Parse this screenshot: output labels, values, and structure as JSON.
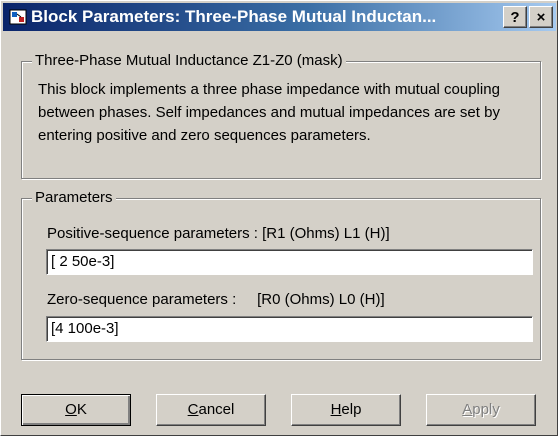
{
  "window": {
    "title": "Block Parameters: Three-Phase Mutual Inductan...",
    "help_button": "?",
    "close_button": "×"
  },
  "mask_group": {
    "legend": "Three-Phase Mutual Inductance Z1-Z0 (mask)",
    "description": "This block implements a three phase impedance with mutual coupling between phases.  Self impedances and mutual impedances are set by entering positive and zero sequences parameters."
  },
  "parameters_group": {
    "legend": "Parameters",
    "positive_label": "Positive-sequence parameters : [R1 (Ohms) L1 (H)]",
    "positive_value": "[ 2  50e-3]",
    "zero_label": "Zero-sequence parameters :     [R0 (Ohms) L0 (H)]",
    "zero_value": "[4  100e-3]"
  },
  "buttons": {
    "ok": {
      "mnemonic": "O",
      "rest": "K"
    },
    "cancel": {
      "mnemonic": "C",
      "rest": "ancel"
    },
    "help": {
      "mnemonic": "H",
      "rest": "elp"
    },
    "apply": {
      "mnemonic": "A",
      "rest": "pply"
    }
  }
}
